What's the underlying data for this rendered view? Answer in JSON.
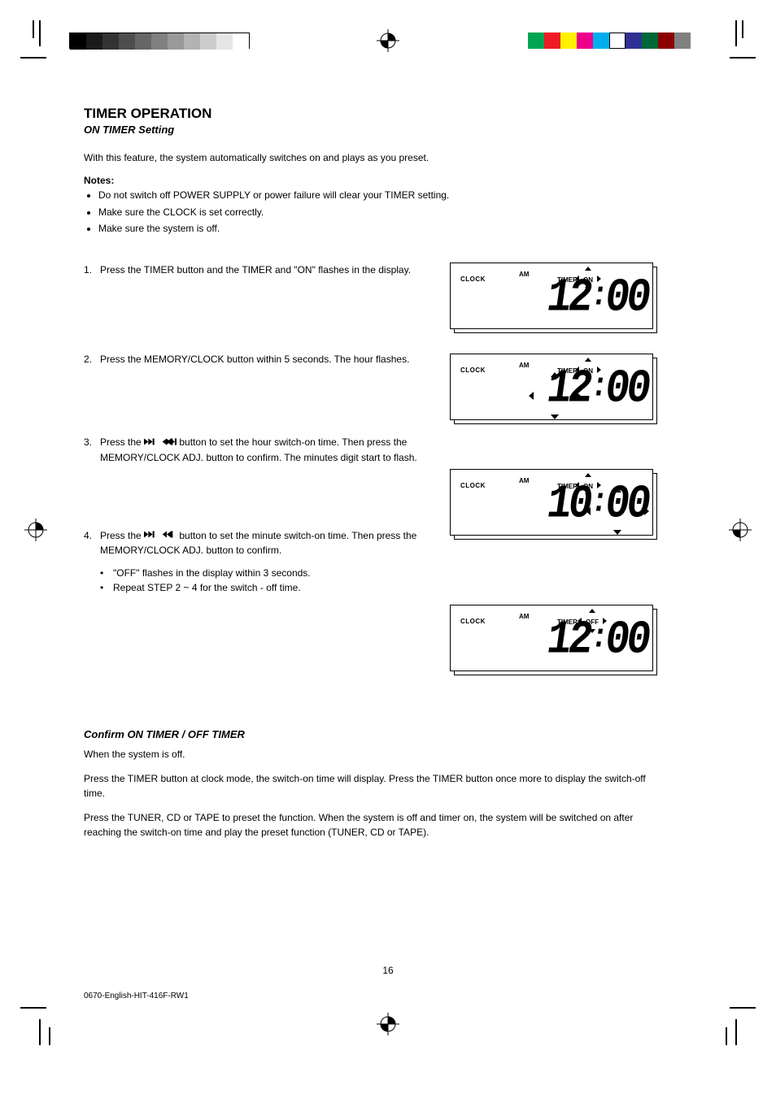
{
  "page": {
    "title": "TIMER OPERATION",
    "subtitle": "ON TIMER Setting",
    "intro": "With this feature, the system automatically switches on and plays as you preset.",
    "notes_label": "Notes:",
    "notes": [
      "Do not switch off POWER SUPPLY or power failure will clear your TIMER setting.",
      "Make sure the CLOCK is set correctly.",
      "Make sure the system is off."
    ],
    "steps": [
      {
        "n": "1.",
        "text": "Press the TIMER button and the TIMER and \"ON\" flashes in the display."
      },
      {
        "n": "2.",
        "text": "Press the MEMORY/CLOCK button within 5 seconds. The hour flashes."
      },
      {
        "n": "3.",
        "text_pre": "Press the ",
        "text_post": " button to set the hour switch-on time. Then press the MEMORY/CLOCK ADJ. button to confirm. The minutes digit start to flash."
      },
      {
        "n": "4.",
        "text_pre": "Press the ",
        "text_post": " button to set the minute switch-on time. Then press the MEMORY/CLOCK ADJ. button to confirm."
      }
    ],
    "sub_steps": [
      {
        "dot": "•",
        "text": "\"OFF\" flashes in the display within 3 seconds."
      },
      {
        "dot": "•",
        "text": "Repeat STEP 2 ~ 4 for the switch - off time."
      }
    ],
    "confirm": {
      "heading": "Confirm ON TIMER / OFF TIMER",
      "p1": "When the system is off.",
      "p2": "Press the TIMER button at clock mode, the switch-on time will display. Press the TIMER button once more to display the switch-off time.",
      "p3": "Press the TUNER, CD or TAPE to preset the function. When the system is off and timer on, the system will be switched on after reaching the switch-on time and play the preset function (TUNER, CD or TAPE)."
    },
    "lcd": [
      {
        "clock": "CLOCK",
        "am": "AM",
        "timer": "TIMER",
        "state": "ON",
        "time_h": "12",
        "time_m": "00",
        "arrows_on_state": true,
        "arrows_on_hr": false,
        "arrows_on_min": false
      },
      {
        "clock": "CLOCK",
        "am": "AM",
        "timer": "TIMER",
        "state": "ON",
        "time_h": "12",
        "time_m": "00",
        "arrows_on_state": true,
        "arrows_on_hr": true,
        "arrows_on_min": false
      },
      {
        "clock": "CLOCK",
        "am": "AM",
        "timer": "TIMER",
        "state": "ON",
        "time_h": "10",
        "time_m": "00",
        "arrows_on_state": true,
        "arrows_on_hr": false,
        "arrows_on_min": true
      },
      {
        "clock": "CLOCK",
        "am": "AM",
        "timer": "TIMER",
        "state": "OFF",
        "time_h": "12",
        "time_m": "00",
        "arrows_on_state": true,
        "arrows_on_hr": false,
        "arrows_on_min": false
      }
    ],
    "page_number": "16",
    "footer": "0670-English-HIT-416F-RW1",
    "colorbar_left": [
      "#000000",
      "#1a1a1a",
      "#333333",
      "#4d4d4d",
      "#666666",
      "#808080",
      "#999999",
      "#b3b3b3",
      "#cccccc",
      "#e6e6e6",
      "#ffffff"
    ],
    "colorbar_right": [
      "#00a651",
      "#ed1c24",
      "#fff200",
      "#ec008c",
      "#00aeef",
      "#ffffff",
      "#2e3192",
      "#006838",
      "#8b0000",
      "#808080"
    ]
  }
}
